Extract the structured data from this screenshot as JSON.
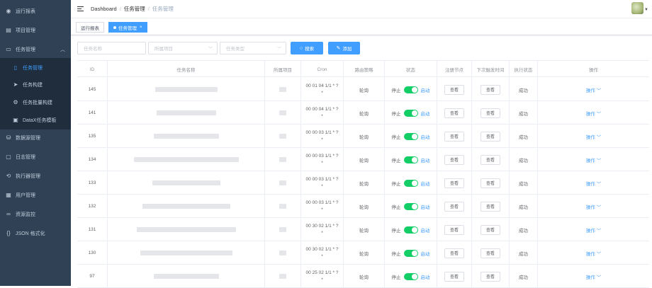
{
  "sidebar": {
    "items": [
      {
        "label": "运行报表",
        "icon": "dashboard-icon"
      },
      {
        "label": "项目管理",
        "icon": "project-icon"
      },
      {
        "label": "任务管理",
        "icon": "monitor-icon"
      },
      {
        "label": "任务管理",
        "icon": "document-icon"
      },
      {
        "label": "任务构建",
        "icon": "send-icon"
      },
      {
        "label": "任务批量构建",
        "icon": "batch-icon"
      },
      {
        "label": "DataX任务模板",
        "icon": "template-icon"
      },
      {
        "label": "数据源管理",
        "icon": "database-icon"
      },
      {
        "label": "日志管理",
        "icon": "log-icon"
      },
      {
        "label": "执行器管理",
        "icon": "executor-icon"
      },
      {
        "label": "用户管理",
        "icon": "user-icon"
      },
      {
        "label": "资源监控",
        "icon": "monitor-resource-icon"
      },
      {
        "label": "JSON 格式化",
        "icon": "code-icon"
      }
    ]
  },
  "header": {
    "breadcrumb": [
      "Dashboard",
      "任务管理",
      "任务管理"
    ]
  },
  "tags": {
    "items": [
      "运行报表",
      "任务管理"
    ],
    "close_symbol": "×"
  },
  "filters": {
    "task_name_placeholder": "任务名称",
    "project_placeholder": "所属项目",
    "task_type_placeholder": "任务类型",
    "search_label": "搜索",
    "add_label": "添加"
  },
  "table": {
    "columns": [
      "ID",
      "任务名称",
      "所属项目",
      "Cron",
      "路由策略",
      "状态",
      "注册节点",
      "下次触发时间",
      "执行状态",
      "操作"
    ],
    "rows": [
      {
        "id": "145",
        "cron": "00 01 04 1/1 * ? *",
        "route": "轮询",
        "stop": "停止",
        "start": "启动",
        "node": "查看",
        "next": "查看",
        "exec": "成功",
        "op": "操作"
      },
      {
        "id": "141",
        "cron": "00 00 04 1/1 * ? *",
        "route": "轮询",
        "stop": "停止",
        "start": "启动",
        "node": "查看",
        "next": "查看",
        "exec": "成功",
        "op": "操作"
      },
      {
        "id": "135",
        "cron": "00 00 03 1/1 * ? *",
        "route": "轮询",
        "stop": "停止",
        "start": "启动",
        "node": "查看",
        "next": "查看",
        "exec": "成功",
        "op": "操作"
      },
      {
        "id": "134",
        "cron": "00 00 03 1/1 * ? *",
        "route": "轮询",
        "stop": "停止",
        "start": "启动",
        "node": "查看",
        "next": "查看",
        "exec": "成功",
        "op": "操作"
      },
      {
        "id": "133",
        "cron": "00 00 03 1/1 * ? *",
        "route": "轮询",
        "stop": "停止",
        "start": "启动",
        "node": "查看",
        "next": "查看",
        "exec": "成功",
        "op": "操作"
      },
      {
        "id": "132",
        "cron": "00 00 03 1/1 * ? *",
        "route": "轮询",
        "stop": "停止",
        "start": "启动",
        "node": "查看",
        "next": "查看",
        "exec": "成功",
        "op": "操作"
      },
      {
        "id": "131",
        "cron": "00 30 02 1/1 * ? *",
        "route": "轮询",
        "stop": "停止",
        "start": "启动",
        "node": "查看",
        "next": "查看",
        "exec": "成功",
        "op": "操作"
      },
      {
        "id": "130",
        "cron": "00 30 02 1/1 * ? *",
        "route": "轮询",
        "stop": "停止",
        "start": "启动",
        "node": "查看",
        "next": "查看",
        "exec": "成功",
        "op": "操作"
      },
      {
        "id": "97",
        "cron": "00 25 02 1/1 * ? *",
        "route": "轮询",
        "stop": "停止",
        "start": "启动",
        "node": "查看",
        "next": "查看",
        "exec": "成功",
        "op": "操作"
      }
    ]
  },
  "colors": {
    "sidebar_bg": "#304156",
    "accent": "#409eff",
    "switch_on": "#13ce66"
  }
}
